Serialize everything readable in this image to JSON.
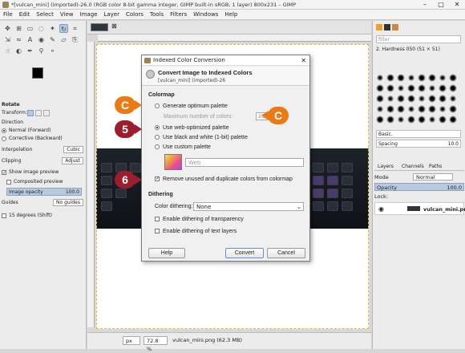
{
  "window": {
    "title": "*[vulcan_mini] (imported)-26.0 (RGB color 8-bit gamma integer, GIMP built-in sRGB, 1 layer) 800x231 – GIMP",
    "controls": {
      "minimize": "–",
      "maximize": "□",
      "close": "✕"
    }
  },
  "menubar": [
    "File",
    "Edit",
    "Select",
    "View",
    "Image",
    "Layer",
    "Colors",
    "Tools",
    "Filters",
    "Windows",
    "Help"
  ],
  "left_panel": {
    "section": "Rotate",
    "transform_label": "Transform:",
    "direction_label": "Direction",
    "direction_options": [
      {
        "label": "Normal (Forward)",
        "selected": true
      },
      {
        "label": "Corrective (Backward)",
        "selected": false
      }
    ],
    "interpolation": {
      "label": "Interpolation",
      "value": "Cubic"
    },
    "clipping": {
      "label": "Clipping",
      "value": "Adjust"
    },
    "show_preview": {
      "label": "Show image preview",
      "checked": true
    },
    "composited_preview": {
      "label": "Composited preview",
      "checked": false
    },
    "image_opacity": {
      "label": "Image opacity",
      "value": "100.0"
    },
    "guides": {
      "label": "Guides",
      "value": "No guides"
    },
    "snap": {
      "label": "15 degrees (Shift)",
      "checked": false
    }
  },
  "status_bar": {
    "unit": "px",
    "zoom": "72.8 %",
    "file_info": "vulcan_mini.png (62.3 MB)"
  },
  "right_panel": {
    "filter_placeholder": "filter",
    "brush_name": "2. Hardness 050 (51 × 51)",
    "brush_category": "Basic.",
    "spacing_label": "Spacing",
    "spacing_value": "10.0",
    "tabs": [
      "Layers",
      "Channels",
      "Paths"
    ],
    "mode_label": "Mode",
    "mode_value": "Normal",
    "opacity_label": "Opacity",
    "opacity_value": "100.0",
    "lock_label": "Lock:",
    "layer_name": "vulcan_mini.png"
  },
  "dialog": {
    "title": "Indexed Color Conversion",
    "close": "✕",
    "heading": "Convert Image to Indexed Colors",
    "subheading": "[vulcan_mini] (imported)-26",
    "colormap_section": "Colormap",
    "options": [
      {
        "label": "Generate optimum palette",
        "selected": false
      },
      {
        "label": "Use web-optimized palette",
        "selected": true
      },
      {
        "label": "Use black and white (1-bit) palette",
        "selected": false
      },
      {
        "label": "Use custom palette",
        "selected": false
      }
    ],
    "max_colors_label": "Maximum number of colors:",
    "max_colors_value": "256",
    "custom_palette_name": "Web",
    "remove_unused_label": "Remove unused and duplicate colors from colormap",
    "remove_unused_checked": true,
    "dithering_section": "Dithering",
    "color_dithering_label": "Color dithering:",
    "color_dithering_value": "None",
    "transparency_dither_label": "Enable dithering of transparency",
    "text_layers_dither_label": "Enable dithering of text layers",
    "buttons": {
      "help": "Help",
      "convert": "Convert",
      "cancel": "Cancel"
    }
  },
  "callouts": {
    "c_top": "C",
    "c_right": "C",
    "step_5": "5",
    "step_6": "6"
  },
  "colors": {
    "callout_orange": "#ea7a16",
    "callout_red": "#9b1e2e"
  }
}
